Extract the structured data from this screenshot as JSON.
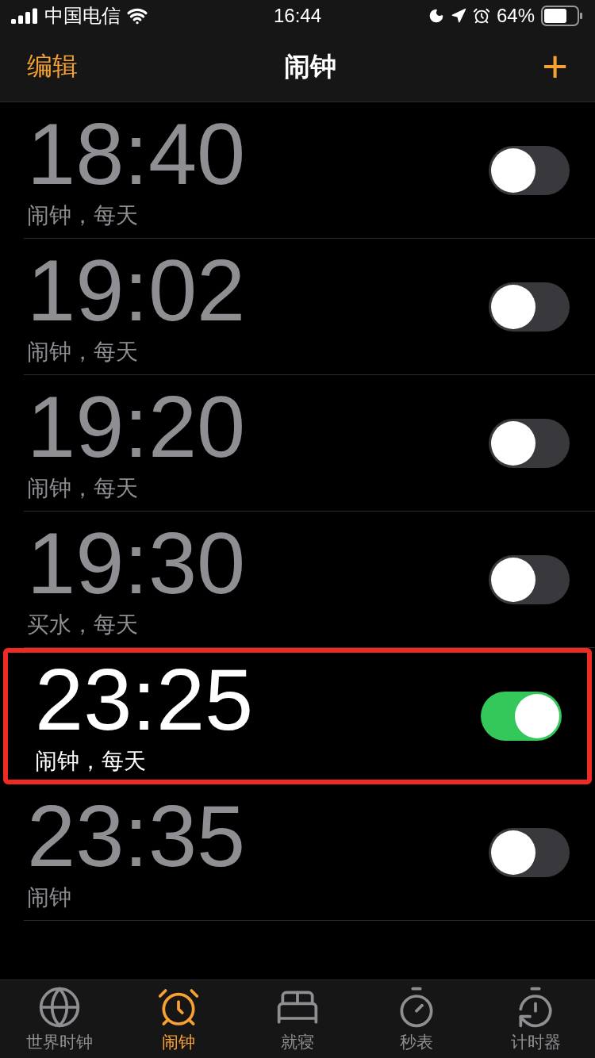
{
  "status_bar": {
    "carrier": "中国电信",
    "time": "16:44",
    "battery": "64%"
  },
  "nav": {
    "left": "编辑",
    "title": "闹钟",
    "right": "+"
  },
  "alarms": [
    {
      "time": "18:40",
      "label": "闹钟，每天",
      "on": false,
      "highlighted": false
    },
    {
      "time": "19:02",
      "label": "闹钟，每天",
      "on": false,
      "highlighted": false
    },
    {
      "time": "19:20",
      "label": "闹钟，每天",
      "on": false,
      "highlighted": false
    },
    {
      "time": "19:30",
      "label": "买水，每天",
      "on": false,
      "highlighted": false
    },
    {
      "time": "23:25",
      "label": "闹钟，每天",
      "on": true,
      "highlighted": true
    },
    {
      "time": "23:35",
      "label": "闹钟",
      "on": false,
      "highlighted": false
    }
  ],
  "tabs": [
    {
      "kind": "globe",
      "label": "世界时钟",
      "selected": false
    },
    {
      "kind": "alarm",
      "label": "闹钟",
      "selected": true
    },
    {
      "kind": "bed",
      "label": "就寝",
      "selected": false
    },
    {
      "kind": "stopwatch",
      "label": "秒表",
      "selected": false
    },
    {
      "kind": "timer",
      "label": "计时器",
      "selected": false
    }
  ]
}
